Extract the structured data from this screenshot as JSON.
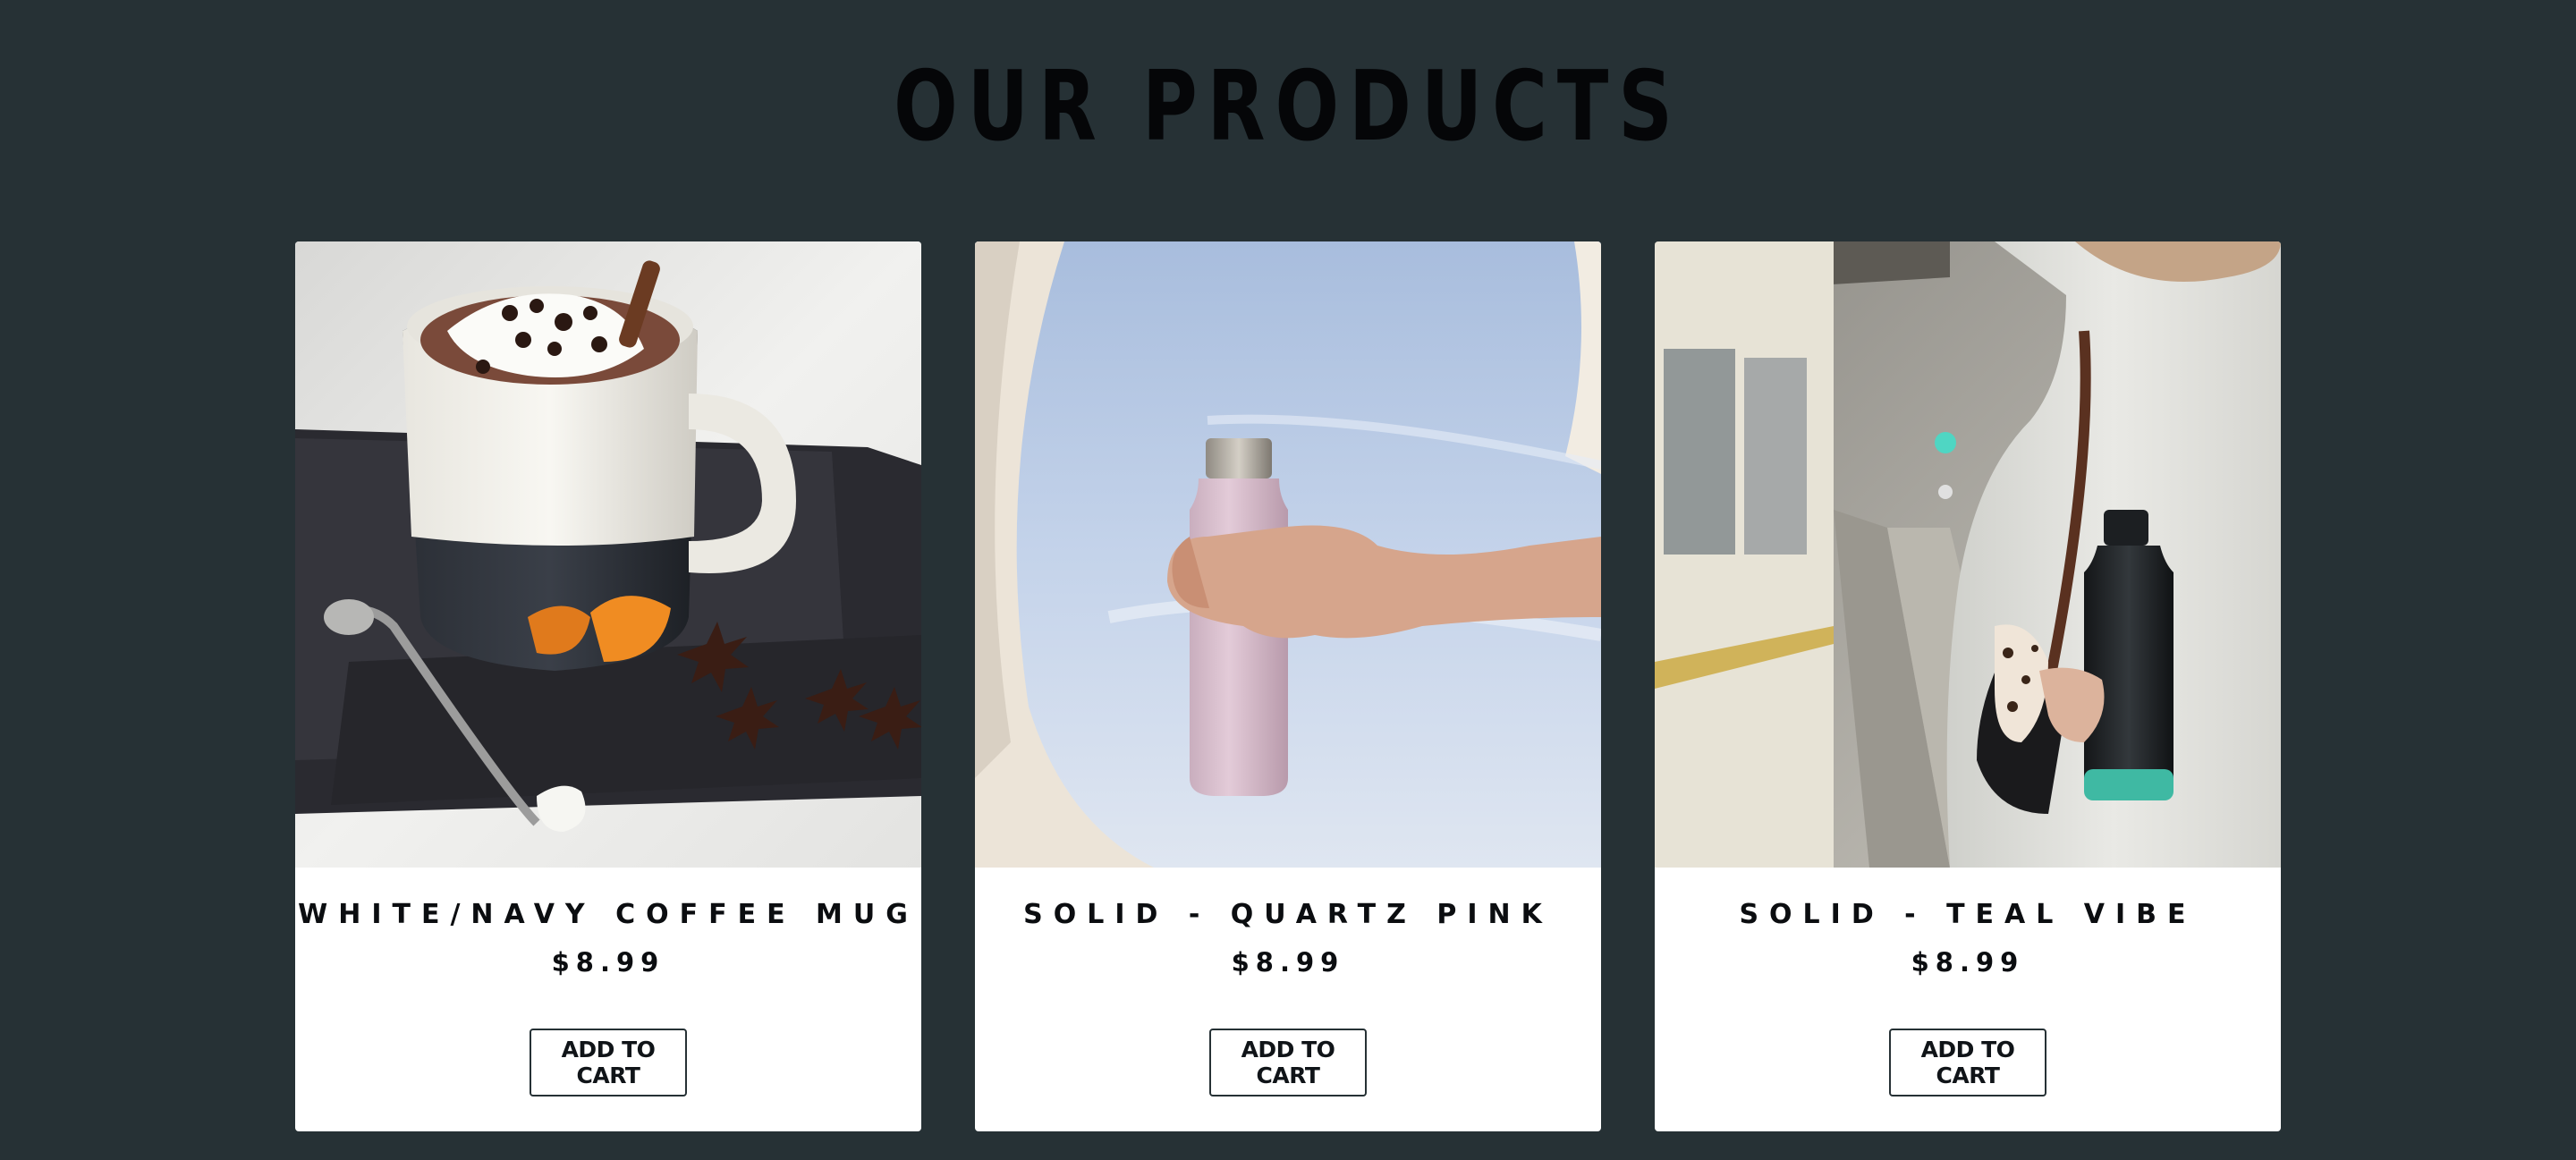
{
  "section": {
    "title": "OUR PRODUCTS"
  },
  "products": [
    {
      "name": "WHITE/NAVY COFFEE MUG",
      "price": "$8.99",
      "button_label": "ADD TO CART",
      "image_alt": "coffee-mug-photo"
    },
    {
      "name": "SOLID - QUARTZ PINK",
      "price": "$8.99",
      "button_label": "ADD TO CART",
      "image_alt": "pink-bottle-photo"
    },
    {
      "name": "SOLID - TEAL VIBE",
      "price": "$8.99",
      "button_label": "ADD TO CART",
      "image_alt": "teal-bottle-photo"
    }
  ],
  "colors": {
    "background": "#263135",
    "card": "#ffffff",
    "text": "#0b0d10",
    "pink_bottle": "#d9bfcf",
    "teal_accent": "#3fb9a3"
  }
}
